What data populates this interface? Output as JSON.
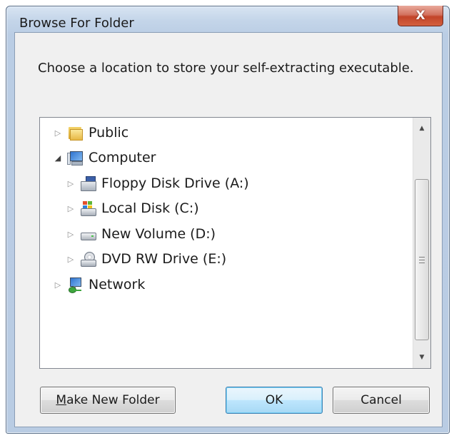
{
  "window": {
    "title": "Browse For Folder",
    "close_glyph": "X"
  },
  "dialog": {
    "instruction": "Choose a location to store your self-extracting executable."
  },
  "tree": {
    "items": [
      {
        "label": "Public",
        "icon": "folder-icon",
        "expander": "collapsed"
      },
      {
        "label": "Computer",
        "icon": "computer-icon",
        "expander": "expanded"
      },
      {
        "label": "Floppy Disk Drive (A:)",
        "icon": "floppy-drive-icon",
        "expander": "collapsed"
      },
      {
        "label": "Local Disk (C:)",
        "icon": "local-disk-icon",
        "expander": "collapsed"
      },
      {
        "label": "New Volume (D:)",
        "icon": "drive-icon",
        "expander": "collapsed"
      },
      {
        "label": "DVD RW Drive (E:)",
        "icon": "dvd-drive-icon",
        "expander": "collapsed"
      },
      {
        "label": "Network",
        "icon": "network-icon",
        "expander": "collapsed"
      }
    ]
  },
  "buttons": {
    "make_new_folder_first": "M",
    "make_new_folder_rest": "ake New Folder",
    "ok": "OK",
    "cancel": "Cancel"
  },
  "colors": {
    "close_button": "#c24429",
    "default_button_border": "#3c7fb1",
    "frame": "#b9cce3"
  }
}
